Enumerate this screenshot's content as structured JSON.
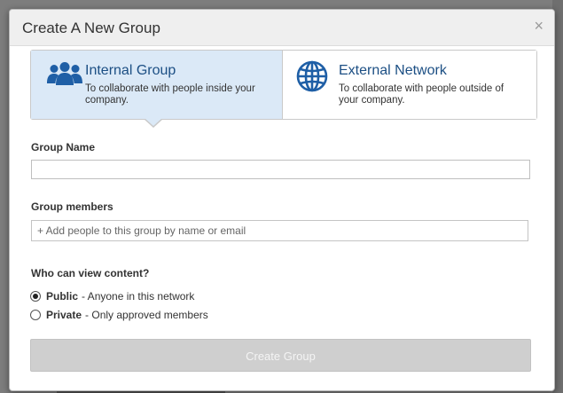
{
  "dialog": {
    "title": "Create A New Group",
    "close_label": "×"
  },
  "group_types": [
    {
      "title": "Internal Group",
      "description": "To collaborate with people inside your company.",
      "icon": "group-people-icon",
      "selected": true
    },
    {
      "title": "External Network",
      "description": "To collaborate with people outside of your company.",
      "icon": "globe-icon",
      "selected": false
    }
  ],
  "group_name": {
    "label": "Group Name",
    "value": ""
  },
  "group_members": {
    "label": "Group members",
    "placeholder": "+ Add people to this group by name or email"
  },
  "visibility": {
    "label": "Who can view content?",
    "options": [
      {
        "name": "Public",
        "description": "- Anyone in this network",
        "checked": true
      },
      {
        "name": "Private",
        "description": "- Only approved members",
        "checked": false
      }
    ]
  },
  "submit_label": "Create Group",
  "colors": {
    "accent": "#1c4f84",
    "selected_tab_bg": "#dbe9f7",
    "disabled_button": "#cfcfcf"
  }
}
